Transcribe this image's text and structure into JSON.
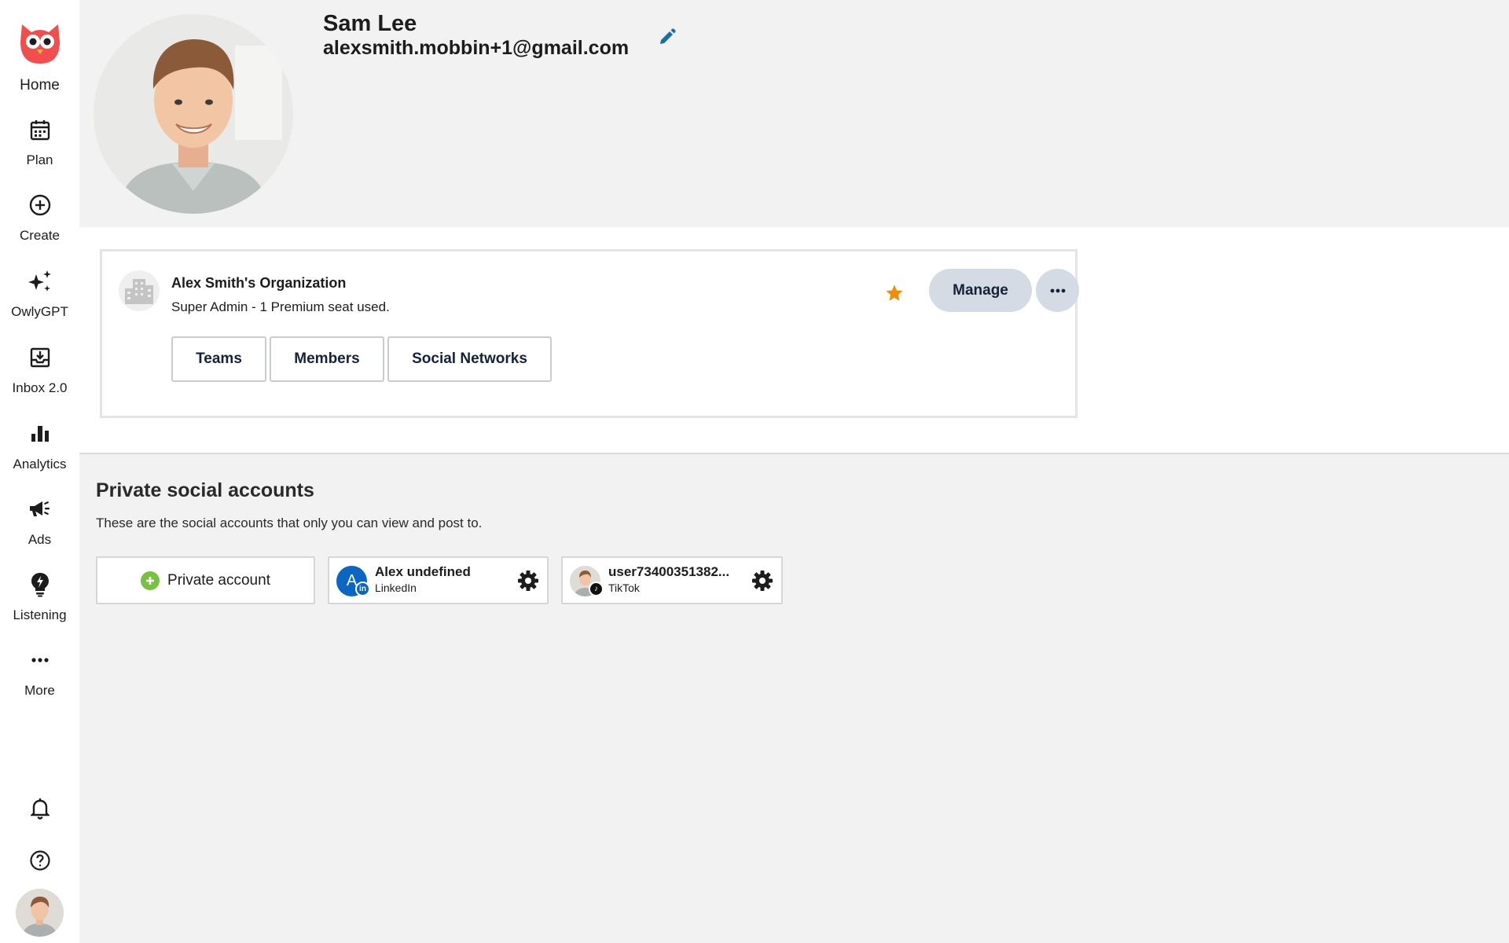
{
  "sidebar": {
    "home_label": "Home",
    "items": [
      {
        "label": "Plan",
        "icon": "calendar-icon"
      },
      {
        "label": "Create",
        "icon": "plus-circle-icon"
      },
      {
        "label": "OwlyGPT",
        "icon": "sparkles-icon"
      },
      {
        "label": "Inbox 2.0",
        "icon": "inbox-icon"
      },
      {
        "label": "Analytics",
        "icon": "bar-chart-icon"
      },
      {
        "label": "Ads",
        "icon": "megaphone-icon"
      },
      {
        "label": "Listening",
        "icon": "lightbulb-icon"
      },
      {
        "label": "More",
        "icon": "ellipsis-icon"
      }
    ]
  },
  "profile": {
    "name": "Sam Lee",
    "email": "alexsmith.mobbin+1@gmail.com"
  },
  "organization": {
    "name": "Alex Smith's Organization",
    "subtitle": "Super Admin - 1 Premium seat used.",
    "tabs": [
      "Teams",
      "Members",
      "Social Networks"
    ],
    "manage_label": "Manage"
  },
  "private_accounts": {
    "title": "Private social accounts",
    "description": "These are the social accounts that only you can view and post to.",
    "add_label": "Private account",
    "accounts": [
      {
        "name": "Alex undefined",
        "network": "LinkedIn",
        "initial": "A"
      },
      {
        "name": "user73400351382...",
        "network": "TikTok"
      }
    ]
  },
  "colors": {
    "accent": "#15233a",
    "brand_red": "#f34e4e",
    "star": "#f28c00",
    "edit_blue": "#1b6fa8",
    "linkedin": "#0a66c2",
    "add_green": "#79c143"
  }
}
